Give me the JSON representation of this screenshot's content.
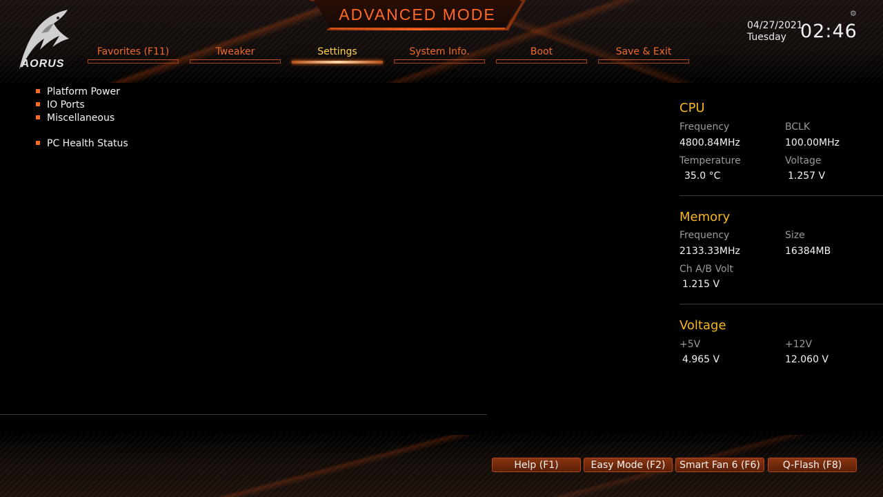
{
  "header": {
    "title": "ADVANCED MODE",
    "logo_text": "AORUS",
    "date": "04/27/2021",
    "day": "Tuesday",
    "time": "02:46"
  },
  "tabs": [
    {
      "label": "Favorites (F11)",
      "active": false
    },
    {
      "label": "Tweaker",
      "active": false
    },
    {
      "label": "Settings",
      "active": true
    },
    {
      "label": "System Info.",
      "active": false
    },
    {
      "label": "Boot",
      "active": false
    },
    {
      "label": "Save & Exit",
      "active": false
    }
  ],
  "menu": {
    "items": [
      {
        "label": "Platform Power"
      },
      {
        "label": "IO Ports"
      },
      {
        "label": "Miscellaneous"
      },
      {
        "label": "PC Health Status"
      }
    ]
  },
  "panel": {
    "cpu": {
      "title": "CPU",
      "frequency_label": "Frequency",
      "frequency_value": "4800.84MHz",
      "bclk_label": "BCLK",
      "bclk_value": "100.00MHz",
      "temperature_label": "Temperature",
      "temperature_value": "35.0 °C",
      "voltage_label": "Voltage",
      "voltage_value": "1.257 V"
    },
    "memory": {
      "title": "Memory",
      "frequency_label": "Frequency",
      "frequency_value": "2133.33MHz",
      "size_label": "Size",
      "size_value": "16384MB",
      "chab_label": "Ch A/B Volt",
      "chab_value": "1.215 V"
    },
    "voltage": {
      "title": "Voltage",
      "v5_label": "+5V",
      "v5_value": "4.965 V",
      "v12_label": "+12V",
      "v12_value": "12.060 V"
    }
  },
  "footer": {
    "help": "Help (F1)",
    "easy_mode": "Easy Mode (F2)",
    "smart_fan": "Smart Fan 6 (F6)",
    "qflash": "Q-Flash (F8)"
  },
  "colors": {
    "accent": "#ff6a26",
    "active_tab": "#ffd24a",
    "section_title": "#f7b81c"
  }
}
